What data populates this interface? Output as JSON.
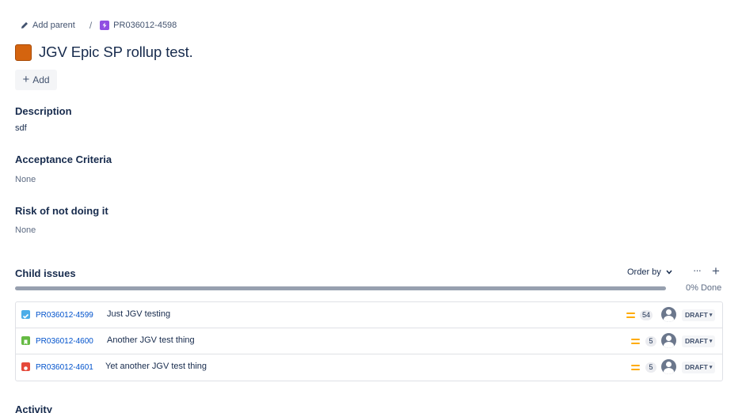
{
  "breadcrumb": {
    "add_parent": "Add parent",
    "separator": "/",
    "epic_key": "PR036012-4598"
  },
  "issue": {
    "title": "JGV Epic SP rollup test.",
    "add_label": "Add",
    "epic_color": "#d4640f"
  },
  "fields": {
    "description": {
      "label": "Description",
      "value": "sdf"
    },
    "acceptance": {
      "label": "Acceptance Criteria",
      "value": "None"
    },
    "risk": {
      "label": "Risk of not doing it",
      "value": "None"
    }
  },
  "child_issues": {
    "title": "Child issues",
    "order_by": "Order by",
    "more": "···",
    "add": "+",
    "progress_done_percent": 0,
    "done_label": "0% Done",
    "items": [
      {
        "type": "task",
        "key": "PR036012-4599",
        "summary": "Just JGV testing",
        "priority": "medium-priority-icon",
        "points": "54",
        "status": "DRAFT"
      },
      {
        "type": "story",
        "key": "PR036012-4600",
        "summary": "Another JGV test thing",
        "priority": "medium-priority-icon",
        "points": "5",
        "status": "DRAFT"
      },
      {
        "type": "bug",
        "key": "PR036012-4601",
        "summary": "Yet another JGV test thing",
        "priority": "medium-priority-icon",
        "points": "5",
        "status": "DRAFT"
      }
    ]
  },
  "activity": {
    "title": "Activity"
  }
}
